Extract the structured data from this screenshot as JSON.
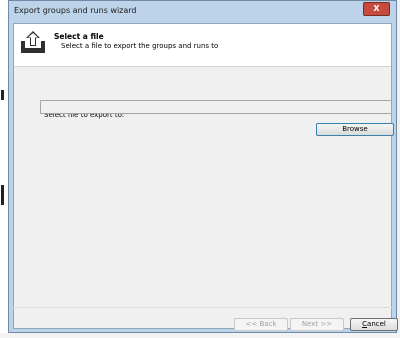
{
  "window": {
    "title": "Export groups and runs wizard",
    "close_label": "X"
  },
  "header": {
    "title": "Select a file",
    "subtitle": "Select a file to export the groups and runs to",
    "icon": "export-icon"
  },
  "form": {
    "label": "Select file to export to:",
    "file_value": "",
    "browse_label": "Browse"
  },
  "footer": {
    "back_label": "<< Back",
    "next_label": "Next >>",
    "cancel_first": "C",
    "cancel_rest": "ancel"
  },
  "colors": {
    "title_bar": "#bcd3ea",
    "close_button": "#c74a3e",
    "client_bg": "#f0f0f0",
    "focus_border": "#3c7fb1"
  }
}
